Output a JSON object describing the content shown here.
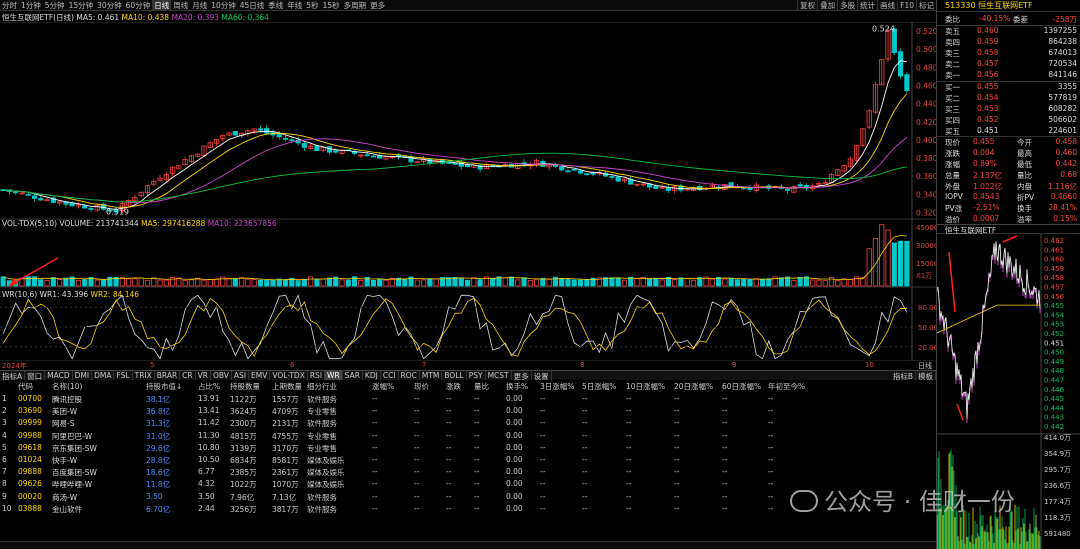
{
  "toolbar": {
    "periods": [
      "分时",
      "1分钟",
      "5分钟",
      "15分钟",
      "30分钟",
      "60分钟",
      "日线",
      "周线",
      "月线",
      "10分钟",
      "45日线",
      "季线",
      "年线",
      "5秒",
      "15秒",
      "多周期",
      "更多"
    ],
    "active": "日线",
    "right": [
      "复权",
      "叠加",
      "多股",
      "统计",
      "画线",
      "F10",
      "标记"
    ]
  },
  "kline": {
    "title": "恒生互联网ETF(日线)",
    "ma5": "MA5: 0.461",
    "ma10": "MA10: 0.438",
    "ma20": "MA20: 0.393",
    "ma60": "MA60: 0.364",
    "high_label": "0.524",
    "low_label": "0.319",
    "price_ticks": [
      "0.520",
      "0.500",
      "0.480",
      "0.460",
      "0.440",
      "0.420",
      "0.400",
      "0.380",
      "0.360",
      "0.340",
      "0.320"
    ]
  },
  "vol": {
    "title": "VOL-TDX(5,10)",
    "volume": "VOLUME: 213741344",
    "ma5": "MA5: 297416288",
    "ma10": "MA10: 223657856",
    "ticks": [
      "45000",
      "30000",
      "15000",
      "X1万"
    ]
  },
  "wr": {
    "title": "WR(10,6)",
    "wr1": "WR1: 43.396",
    "wr2": "WR2: 84.146",
    "ticks": [
      "80.00",
      "50.00",
      "20.00"
    ]
  },
  "dates": {
    "year": "2024年",
    "months": [
      "5",
      "6",
      "7",
      "8",
      "9",
      "10"
    ],
    "right": "日线"
  },
  "indicators": {
    "tabs": [
      "指标A",
      "窗口",
      "MACD",
      "DMI",
      "DMA",
      "FSL",
      "TRIX",
      "BRAR",
      "CR",
      "VR",
      "OBV",
      "ASI",
      "EMV",
      "VOL-TDX",
      "RSI",
      "WR",
      "SAR",
      "KDJ",
      "CCI",
      "ROC",
      "MTM",
      "BOLL",
      "PSY",
      "MCST",
      "更多",
      "设置"
    ],
    "active": "WR",
    "right": [
      "指标B",
      "模板"
    ]
  },
  "table": {
    "headers": [
      "代码",
      "名称(10)",
      "持股市值↓",
      "占比%",
      "持股数量",
      "上期数量",
      "细分行业",
      "涨幅%",
      "现价",
      "涨跌",
      "量比",
      "换手%",
      "3日涨幅%",
      "5日涨幅%",
      "10日涨幅%",
      "20日涨幅%",
      "60日涨幅%",
      "年初至今%"
    ],
    "rows": [
      [
        "1",
        "00700",
        "腾讯控股",
        "38.1亿",
        "13.91",
        "1122万",
        "1557万",
        "软件服务",
        "--",
        "--",
        "--",
        "--",
        "0.00",
        "--",
        "--",
        "--",
        "--",
        "--",
        "--"
      ],
      [
        "2",
        "03690",
        "美团-W",
        "36.8亿",
        "13.41",
        "3624万",
        "4709万",
        "专业零售",
        "--",
        "--",
        "--",
        "--",
        "0.00",
        "--",
        "--",
        "--",
        "--",
        "--",
        "--"
      ],
      [
        "3",
        "09999",
        "网易-S",
        "31.3亿",
        "11.42",
        "2300万",
        "2131万",
        "软件服务",
        "--",
        "--",
        "--",
        "--",
        "0.00",
        "--",
        "--",
        "--",
        "--",
        "--",
        "--"
      ],
      [
        "4",
        "09988",
        "阿里巴巴-W",
        "31.0亿",
        "11.30",
        "4815万",
        "4755万",
        "专业零售",
        "--",
        "--",
        "--",
        "--",
        "0.00",
        "--",
        "--",
        "--",
        "--",
        "--",
        "--"
      ],
      [
        "5",
        "09618",
        "京东集团-SW",
        "29.6亿",
        "10.80",
        "3139万",
        "3170万",
        "专业零售",
        "--",
        "--",
        "--",
        "--",
        "0.00",
        "--",
        "--",
        "--",
        "--",
        "--",
        "--"
      ],
      [
        "6",
        "01024",
        "快手-W",
        "28.8亿",
        "10.50",
        "6834万",
        "8581万",
        "媒体及娱乐",
        "--",
        "--",
        "--",
        "--",
        "0.00",
        "--",
        "--",
        "--",
        "--",
        "--",
        "--"
      ],
      [
        "7",
        "09888",
        "百度集团-SW",
        "18.6亿",
        "6.77",
        "2385万",
        "2361万",
        "媒体及娱乐",
        "--",
        "--",
        "--",
        "--",
        "0.00",
        "--",
        "--",
        "--",
        "--",
        "--",
        "--"
      ],
      [
        "8",
        "09626",
        "哔哩哔哩-W",
        "11.8亿",
        "4.32",
        "1022万",
        "1070万",
        "媒体及娱乐",
        "--",
        "--",
        "--",
        "--",
        "0.00",
        "--",
        "--",
        "--",
        "--",
        "--",
        "--"
      ],
      [
        "9",
        "00020",
        "商汤-W",
        "3.50",
        "3.50",
        "7.96亿",
        "7.13亿",
        "软件服务",
        "--",
        "--",
        "--",
        "--",
        "0.00",
        "--",
        "--",
        "--",
        "--",
        "--",
        "--"
      ],
      [
        "10",
        "03888",
        "金山软件",
        "6.70亿",
        "2.44",
        "3256万",
        "3817万",
        "软件服务",
        "--",
        "--",
        "--",
        "--",
        "0.00",
        "--",
        "--",
        "--",
        "--",
        "--",
        "--"
      ]
    ]
  },
  "side": {
    "code": "513330",
    "name": "恒生互联网ETF",
    "webi_label": "委比",
    "webi": "-40.15%",
    "weicha_label": "委差",
    "weicha": "-258万",
    "sells": [
      [
        "卖五",
        "0.460",
        "1397255"
      ],
      [
        "卖四",
        "0.459",
        "864238"
      ],
      [
        "卖三",
        "0.458",
        "674013"
      ],
      [
        "卖二",
        "0.457",
        "720534"
      ],
      [
        "卖一",
        "0.456",
        "841146"
      ]
    ],
    "buys": [
      [
        "买一",
        "0.455",
        "3355"
      ],
      [
        "买二",
        "0.454",
        "577819"
      ],
      [
        "买三",
        "0.453",
        "608282"
      ],
      [
        "买四",
        "0.452",
        "506602"
      ],
      [
        "买五",
        "0.451",
        "224601"
      ]
    ],
    "stats": [
      [
        "现价",
        "0.455",
        "今开",
        "0.458"
      ],
      [
        "涨跌",
        "0.004",
        "最高",
        "0.460"
      ],
      [
        "涨幅",
        "0.89%",
        "最低",
        "0.442"
      ],
      [
        "总量",
        "2.137亿",
        "量比",
        "0.68"
      ],
      [
        "外盘",
        "1.022亿",
        "内盘",
        "1.116亿"
      ],
      [
        "IOPV",
        "0.4543",
        "折PV",
        "0.4660"
      ],
      [
        "PV涨",
        "-2.51%",
        "换手",
        "28.41%"
      ],
      [
        "溢价",
        "0.0007",
        "溢率",
        "0.15%"
      ]
    ],
    "mini_title": "恒生互联网ETF",
    "mini_ticks": [
      "0.462",
      "0.461",
      "0.460",
      "0.459",
      "0.458",
      "0.457",
      "0.456",
      "0.455",
      "0.454",
      "0.453",
      "0.452",
      "0.451",
      "0.450",
      "0.449",
      "0.448",
      "0.447",
      "0.446",
      "0.445",
      "0.444",
      "0.443",
      "0.442"
    ],
    "mini_vol_ticks": [
      "414.0万",
      "354.9万",
      "295.7万",
      "236.6万",
      "177.4万",
      "118.3万",
      "591480"
    ]
  },
  "watermark": "公众号 · 佳财一份",
  "colors": {
    "up": "#ff4040",
    "down": "#00c8c8",
    "ma5": "#ffffff",
    "ma10": "#ffd700",
    "ma20": "#cc44cc",
    "ma60": "#00c040"
  }
}
